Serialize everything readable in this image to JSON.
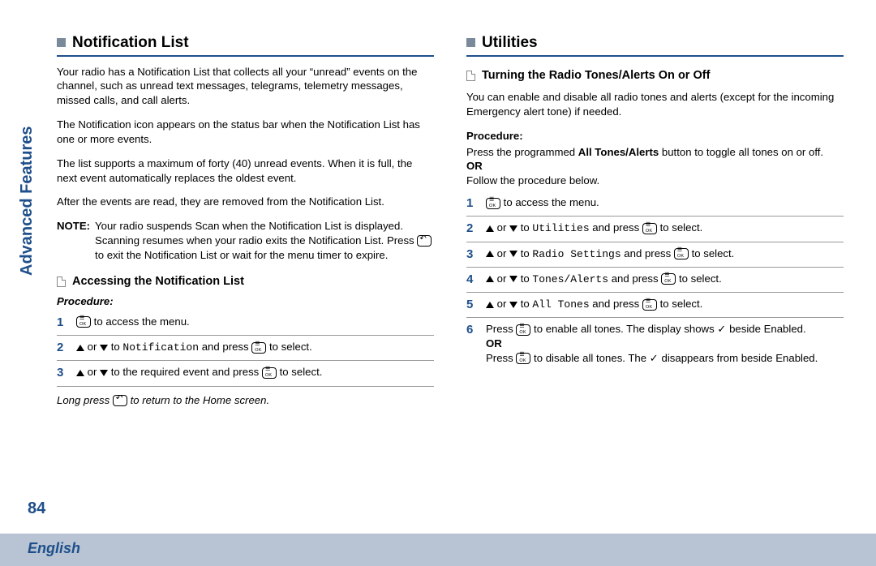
{
  "sideLabel": "Advanced Features",
  "pageNumber": "84",
  "footerLang": "English",
  "left": {
    "heading": "Notification List",
    "p1": "Your radio has a Notification List that collects all your “unread” events on the channel, such as unread text messages, telegrams, telemetry messages, missed calls, and call alerts.",
    "p2": "The Notification icon appears on the status bar when the Notification List has one or more events.",
    "p3": " The list supports a maximum of forty (40) unread events. When it is full, the next event automatically replaces the oldest event.",
    "p4": "After the events are read, they are removed from the Notification List.",
    "noteLabel": "NOTE:",
    "noteA": "Your radio suspends Scan when the Notification List is displayed. Scanning resumes when your radio exits the Notification List. Press ",
    "noteB": " to exit the Notification List or wait for the menu timer to expire.",
    "sub": "Accessing the Notification List",
    "proc": "Procedure:",
    "s1a": " to access the menu.",
    "s2a": " or ",
    "s2b": " to ",
    "s2mono": "Notification",
    "s2c": " and press ",
    "s2d": " to select.",
    "s3a": " or ",
    "s3b": " to the required event and press ",
    "s3c": " to select.",
    "foot": "Long press ",
    "foot2": " to return to the Home screen."
  },
  "right": {
    "heading": "Utilities",
    "sub": "Turning the Radio Tones/Alerts On or Off",
    "intro": "You can enable and disable all radio tones and alerts (except for the incoming Emergency alert tone) if needed.",
    "procLabel": "Procedure:",
    "procA": "Press the programmed ",
    "procBold": "All Tones/Alerts",
    "procB": " button to toggle all tones on or off.",
    "or": "OR",
    "follow": "Follow the procedure below.",
    "s1": " to access the menu.",
    "s2a": " or ",
    "s2b": " to ",
    "s2mono": "Utilities",
    "s2c": " and press ",
    "s2d": " to select.",
    "s3mono": "Radio Settings",
    "s4mono": "Tones/Alerts",
    "s5mono": "All Tones",
    "s6a": "Press ",
    "s6b": " to enable all tones. The display shows ",
    "s6c": " beside Enabled.",
    "s6or": "OR",
    "s6d": "Press ",
    "s6e": " to disable all tones. The ",
    "s6f": " disappears from beside Enabled."
  }
}
